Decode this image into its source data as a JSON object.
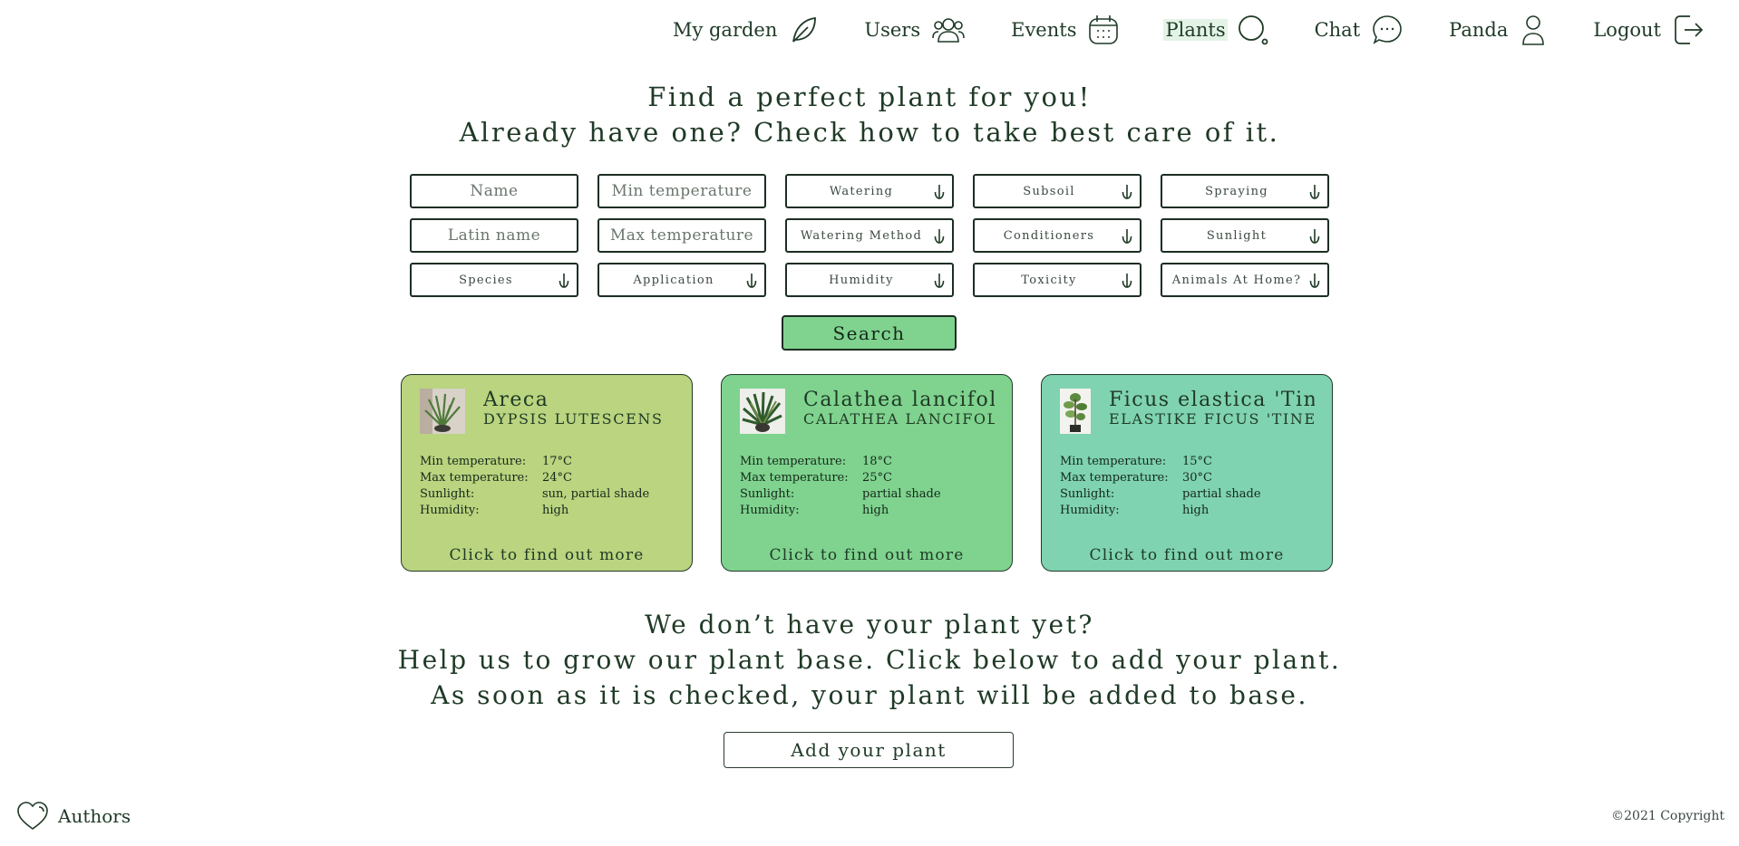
{
  "nav": {
    "items": [
      {
        "label": "My garden",
        "icon": "leaf-icon"
      },
      {
        "label": "Users",
        "icon": "users-icon"
      },
      {
        "label": "Events",
        "icon": "calendar-icon"
      },
      {
        "label": "Plants",
        "icon": "search-icon",
        "active": true
      },
      {
        "label": "Chat",
        "icon": "chat-icon"
      },
      {
        "label": "Panda",
        "icon": "user-icon"
      },
      {
        "label": "Logout",
        "icon": "logout-icon"
      }
    ]
  },
  "headline": {
    "line1": "Find a perfect plant for you!",
    "line2": "Already have one? Check how to take best care of it."
  },
  "filters": {
    "name_placeholder": "Name",
    "min_temp_placeholder": "Min temperature",
    "watering": "Watering",
    "subsoil": "Subsoil",
    "spraying": "Spraying",
    "latin_placeholder": "Latin name",
    "max_temp_placeholder": "Max temperature",
    "watering_method": "Watering Method",
    "conditioners": "Conditioners",
    "sunlight": "Sunlight",
    "species": "Species",
    "application": "Application",
    "humidity": "Humidity",
    "toxicity": "Toxicity",
    "animals": "Animals At Home?"
  },
  "search_label": "Search",
  "card_labels": {
    "min_temp": "Min temperature:",
    "max_temp": "Max temperature:",
    "sunlight": "Sunlight:",
    "humidity": "Humidity:",
    "more": "Click to find out more"
  },
  "cards": [
    {
      "title": "Areca",
      "latin": "DYPSIS LUTESCENS",
      "min_temp": "17°C",
      "max_temp": "24°C",
      "sunlight": "sun, partial shade",
      "humidity": "high",
      "color": "#bad47f"
    },
    {
      "title": "Calathea lancifolia",
      "latin": "CALATHEA LANCIFOLIA",
      "min_temp": "18°C",
      "max_temp": "25°C",
      "sunlight": "partial shade",
      "humidity": "high",
      "color": "#7fd38e"
    },
    {
      "title": "Ficus elastica 'Tineke'",
      "latin": "ELASTIKE FICUS 'TINEKE'",
      "min_temp": "15°C",
      "max_temp": "30°C",
      "sunlight": "partial shade",
      "humidity": "high",
      "color": "#7fd3b0"
    }
  ],
  "cta": {
    "line1": "We don’t have your plant yet?",
    "line2": "Help us to grow our plant base. Click below to add your plant.",
    "line3": "As soon as it is checked, your plant will be added to base."
  },
  "add_plant_label": "Add your plant",
  "footer": {
    "authors": "Authors",
    "copyright": "©2021 Copyright"
  },
  "colors": {
    "text": "#1f3a26",
    "accent": "#7fd38e",
    "border": "#1c2e22"
  }
}
